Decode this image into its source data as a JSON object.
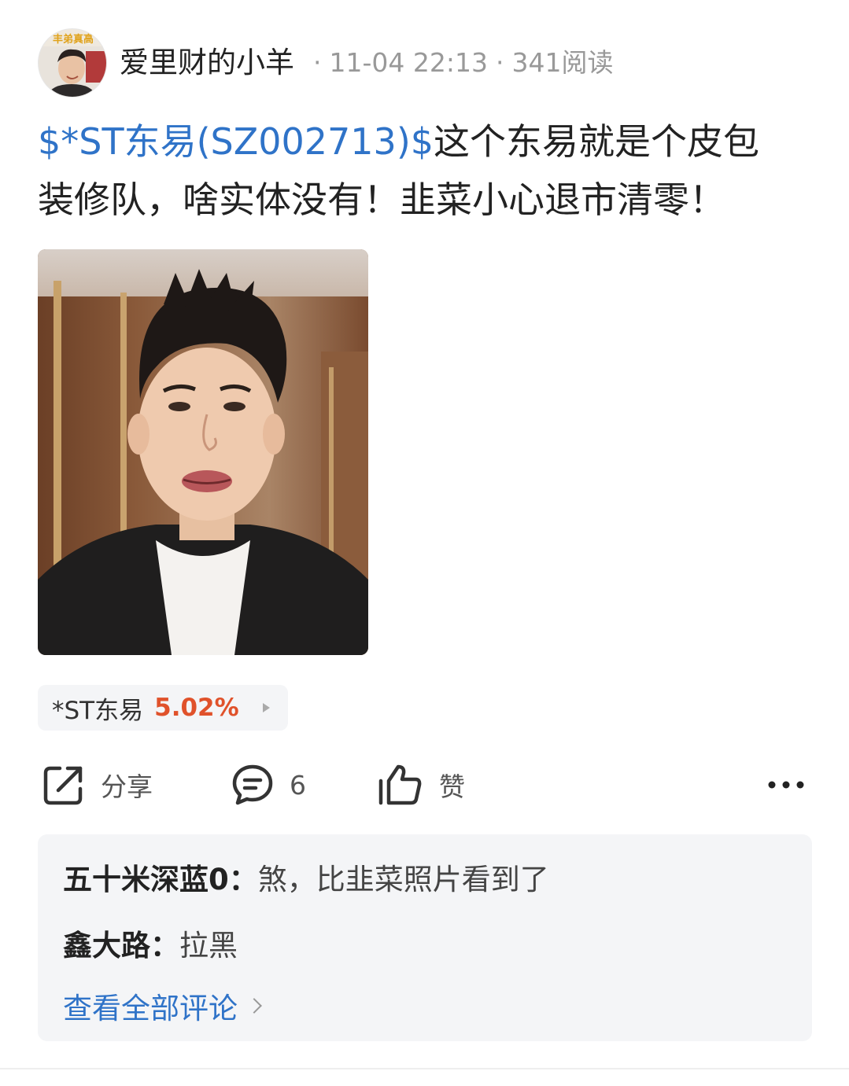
{
  "post": {
    "author": "爱里财的小羊",
    "time": "11-04 22:13",
    "reads": "341阅读",
    "separator": "·",
    "stock_link": "$*ST东易(SZ002713)$",
    "body_line1": "这个东易就是个皮包",
    "body_line2": "装修队，啥实体没有！韭菜小心退市清零！"
  },
  "avatar": {
    "banner_text": "丰弟真高"
  },
  "stock_chip": {
    "name": "*ST东易",
    "change": "5.02%"
  },
  "actions": {
    "share_label": "分享",
    "comment_count": "6",
    "like_label": "赞"
  },
  "comments": {
    "items": [
      {
        "user": "五十米深蓝0：",
        "text": "煞，比韭菜照片看到了"
      },
      {
        "user": "鑫大路：",
        "text": "拉黑"
      }
    ],
    "view_all": "查看全部评论"
  },
  "colors": {
    "link_blue": "#2f73c8",
    "gain_red": "#e0522b",
    "muted_gray": "#999999",
    "panel_bg": "#f4f5f7"
  }
}
